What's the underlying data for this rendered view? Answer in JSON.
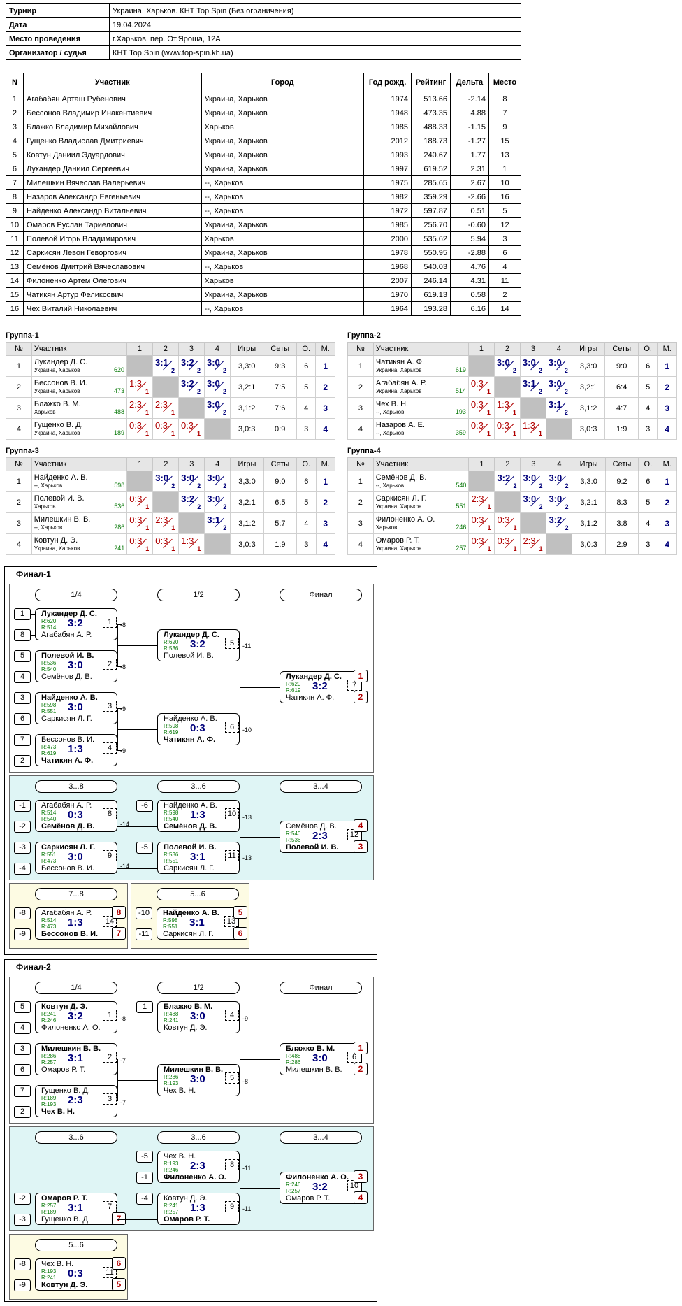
{
  "info": [
    {
      "k": "Турнир",
      "v": "Украина. Харьков. КНТ Top Spin (Без ограничения)"
    },
    {
      "k": "Дата",
      "v": "19.04.2024"
    },
    {
      "k": "Место проведения",
      "v": "г.Харьков, пер. От.Яроша, 12А"
    },
    {
      "k": "Организатор / судья",
      "v": "КНТ Top Spin (www.top-spin.kh.ua)"
    }
  ],
  "plist_headers": [
    "N",
    "Участник",
    "Город",
    "Год рожд.",
    "Рейтинг",
    "Дельта",
    "Место"
  ],
  "plist": [
    [
      "1",
      "Агабабян Арташ Рубенович",
      "Украина, Харьков",
      "1974",
      "513.66",
      "-2.14",
      "8"
    ],
    [
      "2",
      "Бессонов Владимир Инакентиевич",
      "Украина, Харьков",
      "1948",
      "473.35",
      "4.88",
      "7"
    ],
    [
      "3",
      "Блажко Владимир Михайлович",
      "Харьков",
      "1985",
      "488.33",
      "-1.15",
      "9"
    ],
    [
      "4",
      "Гущенко Владислав Дмитриевич",
      "Украина, Харьков",
      "2012",
      "188.73",
      "-1.27",
      "15"
    ],
    [
      "5",
      "Ковтун Даниил Эдуардович",
      "Украина, Харьков",
      "1993",
      "240.67",
      "1.77",
      "13"
    ],
    [
      "6",
      "Лукандер Даниил Сергеевич",
      "Украина, Харьков",
      "1997",
      "619.52",
      "2.31",
      "1"
    ],
    [
      "7",
      "Милешкин Вячеслав Валерьевич",
      "--, Харьков",
      "1975",
      "285.65",
      "2.67",
      "10"
    ],
    [
      "8",
      "Назаров Александр Евгеньевич",
      "--, Харьков",
      "1982",
      "359.29",
      "-2.66",
      "16"
    ],
    [
      "9",
      "Найденко Александр Витальевич",
      "--, Харьков",
      "1972",
      "597.87",
      "0.51",
      "5"
    ],
    [
      "10",
      "Омаров Руслан Тариелович",
      "Украина, Харьков",
      "1985",
      "256.70",
      "-0.60",
      "12"
    ],
    [
      "11",
      "Полевой Игорь Владимирович",
      "Харьков",
      "2000",
      "535.62",
      "5.94",
      "3"
    ],
    [
      "12",
      "Саркисян Левон Геворгович",
      "Украина, Харьков",
      "1978",
      "550.95",
      "-2.88",
      "6"
    ],
    [
      "13",
      "Семёнов Дмитрий Вячеславович",
      "--, Харьков",
      "1968",
      "540.03",
      "4.76",
      "4"
    ],
    [
      "14",
      "Филоненко Артем Олегович",
      "Харьков",
      "2007",
      "246.14",
      "4.31",
      "11"
    ],
    [
      "15",
      "Чатикян Артур Феликсович",
      "Украина, Харьков",
      "1970",
      "619.13",
      "0.58",
      "2"
    ],
    [
      "16",
      "Чех Виталий Николаевич",
      "--, Харьков",
      "1964",
      "193.28",
      "6.16",
      "14"
    ]
  ],
  "group_headers": [
    "№",
    "Участник",
    "1",
    "2",
    "3",
    "4",
    "Игры",
    "Сеты",
    "О.",
    "М."
  ],
  "groups": [
    {
      "title": "Группа-1",
      "rows": [
        {
          "n": "1",
          "name": "Лукандер Д. С.",
          "city": "Украина, Харьков",
          "rating": "620",
          "cells": [
            "x",
            "3:1/2",
            "3:2/2",
            "3:0/2"
          ],
          "games": "3,3:0",
          "sets": "9:3",
          "pts": "6",
          "place": "1"
        },
        {
          "n": "2",
          "name": "Бессонов В. И.",
          "city": "Украина, Харьков",
          "rating": "473",
          "cells": [
            "1:3/1",
            "x",
            "3:2/2",
            "3:0/2"
          ],
          "games": "3,2:1",
          "sets": "7:5",
          "pts": "5",
          "place": "2"
        },
        {
          "n": "3",
          "name": "Блажко В. М.",
          "city": "Харьков",
          "rating": "488",
          "cells": [
            "2:3/1",
            "2:3/1",
            "x",
            "3:0/2"
          ],
          "games": "3,1:2",
          "sets": "7:6",
          "pts": "4",
          "place": "3"
        },
        {
          "n": "4",
          "name": "Гущенко В. Д.",
          "city": "Украина, Харьков",
          "rating": "189",
          "cells": [
            "0:3/1",
            "0:3/1",
            "0:3/1",
            "x"
          ],
          "games": "3,0:3",
          "sets": "0:9",
          "pts": "3",
          "place": "4"
        }
      ]
    },
    {
      "title": "Группа-2",
      "rows": [
        {
          "n": "1",
          "name": "Чатикян А. Ф.",
          "city": "Украина, Харьков",
          "rating": "619",
          "cells": [
            "x",
            "3:0/2",
            "3:0/2",
            "3:0/2"
          ],
          "games": "3,3:0",
          "sets": "9:0",
          "pts": "6",
          "place": "1"
        },
        {
          "n": "2",
          "name": "Агабабян А. Р.",
          "city": "Украина, Харьков",
          "rating": "514",
          "cells": [
            "0:3/1",
            "x",
            "3:1/2",
            "3:0/2"
          ],
          "games": "3,2:1",
          "sets": "6:4",
          "pts": "5",
          "place": "2"
        },
        {
          "n": "3",
          "name": "Чех В. Н.",
          "city": "--, Харьков",
          "rating": "193",
          "cells": [
            "0:3/1",
            "1:3/1",
            "x",
            "3:1/2"
          ],
          "games": "3,1:2",
          "sets": "4:7",
          "pts": "4",
          "place": "3"
        },
        {
          "n": "4",
          "name": "Назаров А. Е.",
          "city": "--, Харьков",
          "rating": "359",
          "cells": [
            "0:3/1",
            "0:3/1",
            "1:3/1",
            "x"
          ],
          "games": "3,0:3",
          "sets": "1:9",
          "pts": "3",
          "place": "4"
        }
      ]
    },
    {
      "title": "Группа-3",
      "rows": [
        {
          "n": "1",
          "name": "Найденко А. В.",
          "city": "--, Харьков",
          "rating": "598",
          "cells": [
            "x",
            "3:0/2",
            "3:0/2",
            "3:0/2"
          ],
          "games": "3,3:0",
          "sets": "9:0",
          "pts": "6",
          "place": "1"
        },
        {
          "n": "2",
          "name": "Полевой И. В.",
          "city": "Харьков",
          "rating": "536",
          "cells": [
            "0:3/1",
            "x",
            "3:2/2",
            "3:0/2"
          ],
          "games": "3,2:1",
          "sets": "6:5",
          "pts": "5",
          "place": "2"
        },
        {
          "n": "3",
          "name": "Милешкин В. В.",
          "city": "--, Харьков",
          "rating": "286",
          "cells": [
            "0:3/1",
            "2:3/1",
            "x",
            "3:1/2"
          ],
          "games": "3,1:2",
          "sets": "5:7",
          "pts": "4",
          "place": "3"
        },
        {
          "n": "4",
          "name": "Ковтун Д. Э.",
          "city": "Украина, Харьков",
          "rating": "241",
          "cells": [
            "0:3/1",
            "0:3/1",
            "1:3/1",
            "x"
          ],
          "games": "3,0:3",
          "sets": "1:9",
          "pts": "3",
          "place": "4"
        }
      ]
    },
    {
      "title": "Группа-4",
      "rows": [
        {
          "n": "1",
          "name": "Семёнов Д. В.",
          "city": "--, Харьков",
          "rating": "540",
          "cells": [
            "x",
            "3:2/2",
            "3:0/2",
            "3:0/2"
          ],
          "games": "3,3:0",
          "sets": "9:2",
          "pts": "6",
          "place": "1"
        },
        {
          "n": "2",
          "name": "Саркисян Л. Г.",
          "city": "Украина, Харьков",
          "rating": "551",
          "cells": [
            "2:3/1",
            "x",
            "3:0/2",
            "3:0/2"
          ],
          "games": "3,2:1",
          "sets": "8:3",
          "pts": "5",
          "place": "2"
        },
        {
          "n": "3",
          "name": "Филоненко А. О.",
          "city": "Харьков",
          "rating": "246",
          "cells": [
            "0:3/1",
            "0:3/1",
            "x",
            "3:2/2"
          ],
          "games": "3,1:2",
          "sets": "3:8",
          "pts": "4",
          "place": "3"
        },
        {
          "n": "4",
          "name": "Омаров Р. Т.",
          "city": "Украина, Харьков",
          "rating": "257",
          "cells": [
            "0:3/1",
            "0:3/1",
            "2:3/1",
            "x"
          ],
          "games": "3,0:3",
          "sets": "2:9",
          "pts": "3",
          "place": "4"
        }
      ]
    }
  ],
  "finals": [
    {
      "title": "Финал-1",
      "pills": [
        "1/4",
        "1/2",
        "Финал",
        "3...8",
        "3...6",
        "3...4",
        "7...8",
        "5...6"
      ],
      "seeds": [
        "1",
        "8",
        "5",
        "4",
        "3",
        "6",
        "7",
        "2",
        "-6",
        "-1",
        "-2",
        "-3",
        "-4",
        "-5",
        "-8",
        "-9",
        "-10",
        "-11"
      ],
      "labels": [
        "-8",
        "-8",
        "-9",
        "-9",
        "-11",
        "-10",
        "-14",
        "-13",
        "-14",
        "-13"
      ],
      "places": [
        "1",
        "2",
        "4",
        "3",
        "8",
        "7",
        "5",
        "6"
      ],
      "matches": [
        {
          "id": "m1",
          "p1": "Лукандер Д. С.",
          "p2": "Агабабян А. Р.",
          "r1": "R:620",
          "r2": "R:514",
          "score": "3:2",
          "no": "1",
          "w": 1
        },
        {
          "id": "m2",
          "p1": "Полевой И. В.",
          "p2": "Семёнов Д. В.",
          "r1": "R:536",
          "r2": "R:540",
          "score": "3:0",
          "no": "2",
          "w": 1
        },
        {
          "id": "m3",
          "p1": "Найденко А. В.",
          "p2": "Саркисян Л. Г.",
          "r1": "R:598",
          "r2": "R:551",
          "score": "3:0",
          "no": "3",
          "w": 1
        },
        {
          "id": "m4",
          "p1": "Бессонов В. И.",
          "p2": "Чатикян А. Ф.",
          "r1": "R:473",
          "r2": "R:619",
          "score": "1:3",
          "no": "4",
          "w": 2
        },
        {
          "id": "m5",
          "p1": "Лукандер Д. С.",
          "p2": "Полевой И. В.",
          "r1": "R:620",
          "r2": "R:536",
          "score": "3:2",
          "no": "5",
          "w": 1
        },
        {
          "id": "m6",
          "p1": "Найденко А. В.",
          "p2": "Чатикян А. Ф.",
          "r1": "R:598",
          "r2": "R:619",
          "score": "0:3",
          "no": "6",
          "w": 2
        },
        {
          "id": "m7",
          "p1": "Лукандер Д. С.",
          "p2": "Чатикян А. Ф.",
          "r1": "R:620",
          "r2": "R:619",
          "score": "3:2",
          "no": "7",
          "w": 1
        },
        {
          "id": "m8",
          "p1": "Агабабян А. Р.",
          "p2": "Семёнов Д. В.",
          "r1": "R:514",
          "r2": "R:540",
          "score": "0:3",
          "no": "8",
          "w": 2
        },
        {
          "id": "m9",
          "p1": "Саркисян Л. Г.",
          "p2": "Бессонов В. И.",
          "r1": "R:551",
          "r2": "R:473",
          "score": "3:0",
          "no": "9",
          "w": 1
        },
        {
          "id": "m10",
          "p1": "Найденко А. В.",
          "p2": "Семёнов Д. В.",
          "r1": "R:598",
          "r2": "R:540",
          "score": "1:3",
          "no": "10",
          "w": 2
        },
        {
          "id": "m11",
          "p1": "Полевой И. В.",
          "p2": "Саркисян Л. Г.",
          "r1": "R:536",
          "r2": "R:551",
          "score": "3:1",
          "no": "11",
          "w": 1
        },
        {
          "id": "m12",
          "p1": "Семёнов Д. В.",
          "p2": "Полевой И. В.",
          "r1": "R:540",
          "r2": "R:536",
          "score": "2:3",
          "no": "12",
          "w": 2
        },
        {
          "id": "m13",
          "p1": "Агабабян А. Р.",
          "p2": "Бессонов В. И.",
          "r1": "R:514",
          "r2": "R:473",
          "score": "1:3",
          "no": "14",
          "w": 2
        },
        {
          "id": "m14",
          "p1": "Найденко А. В.",
          "p2": "Саркисян Л. Г.",
          "r1": "R:598",
          "r2": "R:551",
          "score": "3:1",
          "no": "13",
          "w": 1
        }
      ]
    },
    {
      "title": "Финал-2",
      "pills": [
        "1/4",
        "1/2",
        "Финал",
        "3...6",
        "3...6",
        "3...4",
        "5...6"
      ],
      "seeds": [
        "5",
        "4",
        "1",
        "3",
        "6",
        "7",
        "2",
        "-5",
        "-1",
        "-2",
        "-3",
        "-4",
        "-8",
        "-9"
      ],
      "labels": [
        "-8",
        "-9",
        "-7",
        "-7",
        "-8",
        "-11",
        "-11"
      ],
      "places": [
        "1",
        "2",
        "3",
        "4",
        "7",
        "6",
        "5"
      ],
      "matches": [
        {
          "id": "n1",
          "p1": "Ковтун Д. Э.",
          "p2": "Филоненко А. О.",
          "r1": "R:241",
          "r2": "R:246",
          "score": "3:2",
          "no": "1",
          "w": 1
        },
        {
          "id": "n2",
          "p1": "Блажко В. М.",
          "p2": "Ковтун Д. Э.",
          "r1": "R:488",
          "r2": "R:241",
          "score": "3:0",
          "no": "4",
          "w": 1
        },
        {
          "id": "n3",
          "p1": "Милешкин В. В.",
          "p2": "Омаров Р. Т.",
          "r1": "R:286",
          "r2": "R:257",
          "score": "3:1",
          "no": "2",
          "w": 1
        },
        {
          "id": "n4",
          "p1": "Гущенко В. Д.",
          "p2": "Чех В. Н.",
          "r1": "R:189",
          "r2": "R:193",
          "score": "2:3",
          "no": "3",
          "w": 2
        },
        {
          "id": "n5",
          "p1": "Милешкин В. В.",
          "p2": "Чех В. Н.",
          "r1": "R:286",
          "r2": "R:193",
          "score": "3:0",
          "no": "5",
          "w": 1
        },
        {
          "id": "n6",
          "p1": "Блажко В. М.",
          "p2": "Милешкин В. В.",
          "r1": "R:488",
          "r2": "R:286",
          "score": "3:0",
          "no": "6",
          "w": 1
        },
        {
          "id": "n7",
          "p1": "Чех В. Н.",
          "p2": "Филоненко А. О.",
          "r1": "R:193",
          "r2": "R:246",
          "score": "2:3",
          "no": "8",
          "w": 2
        },
        {
          "id": "n8",
          "p1": "Омаров Р. Т.",
          "p2": "Гущенко В. Д.",
          "r1": "R:257",
          "r2": "R:189",
          "score": "3:1",
          "no": "7",
          "w": 1
        },
        {
          "id": "n9",
          "p1": "Ковтун Д. Э.",
          "p2": "Омаров Р. Т.",
          "r1": "R:241",
          "r2": "R:257",
          "score": "1:3",
          "no": "9",
          "w": 2
        },
        {
          "id": "n10",
          "p1": "Филоненко А. О.",
          "p2": "Омаров Р. Т.",
          "r1": "R:246",
          "r2": "R:257",
          "score": "3:2",
          "no": "10",
          "w": 1
        },
        {
          "id": "n11",
          "p1": "Чех В. Н.",
          "p2": "Ковтун Д. Э.",
          "r1": "R:193",
          "r2": "R:241",
          "score": "0:3",
          "no": "11",
          "w": 2
        }
      ]
    }
  ]
}
